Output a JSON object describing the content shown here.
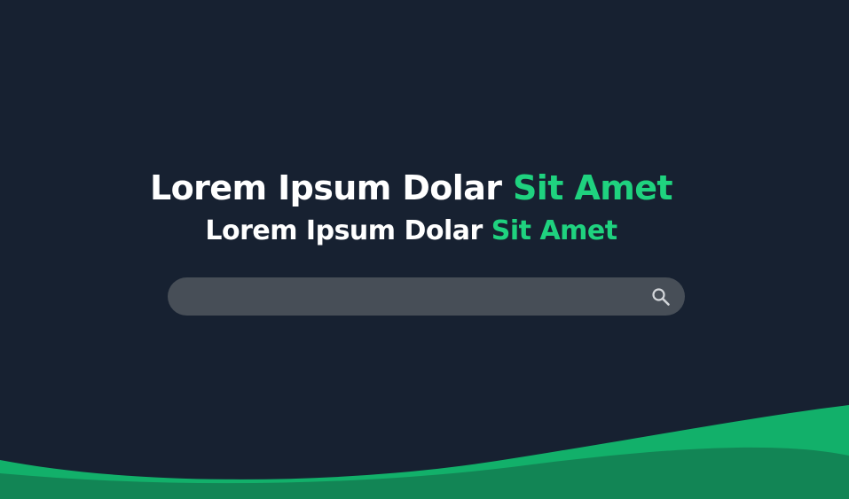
{
  "hero": {
    "heading": {
      "text": "Lorem Ipsum Dolar",
      "accent": "Sit Amet"
    },
    "subheading": {
      "text": "Lorem Ipsum Dolar",
      "accent": "Sit Amet"
    },
    "search": {
      "value": "",
      "placeholder": "",
      "icon": "search-icon"
    }
  },
  "colors": {
    "background": "#172131",
    "accent": "#1fd27f",
    "search_bar": "#474e57",
    "wave_light": "#12b06a",
    "wave_dark": "#128555"
  }
}
